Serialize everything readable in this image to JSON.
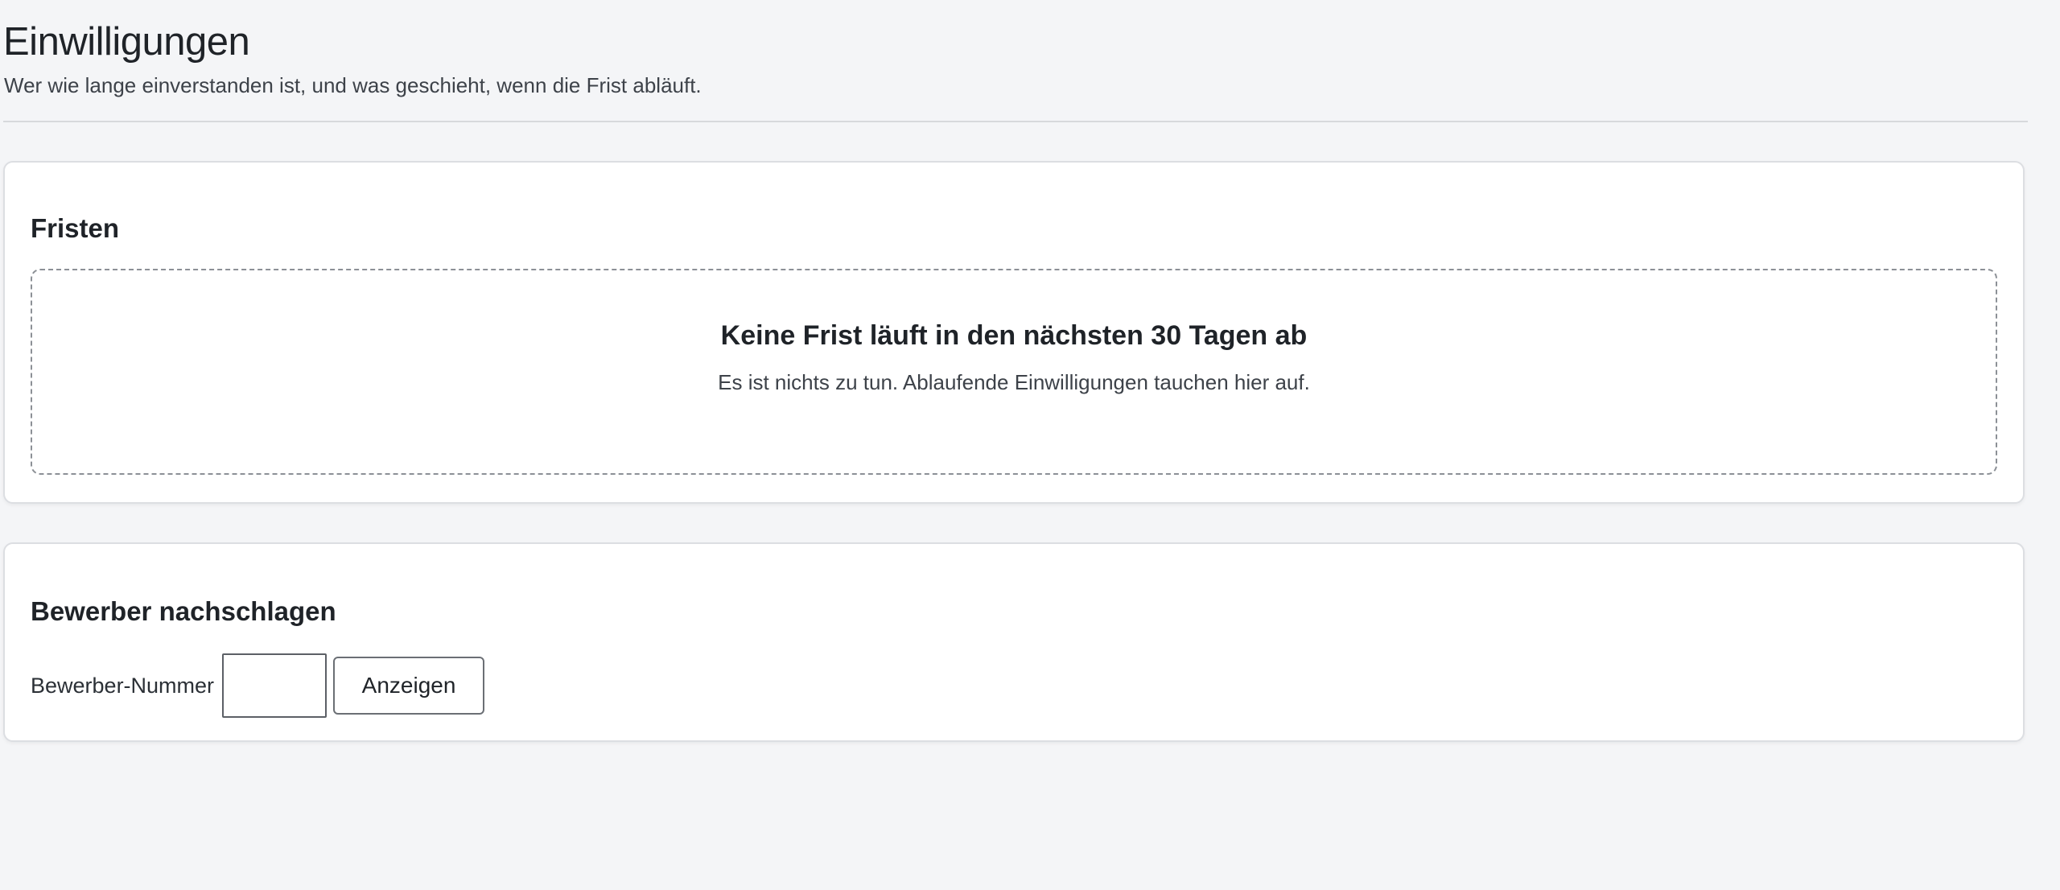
{
  "header": {
    "title": "Einwilligungen",
    "subtitle": "Wer wie lange einverstanden ist, und was geschieht, wenn die Frist abläuft."
  },
  "deadlines": {
    "title": "Fristen",
    "empty_title": "Keine Frist läuft in den nächsten 30 Tagen ab",
    "empty_text": "Es ist nichts zu tun. Ablaufende Einwilligungen tauchen hier auf."
  },
  "lookup": {
    "title": "Bewerber nachschlagen",
    "field_label": "Bewerber-Nummer",
    "field_value": "",
    "button_label": "Anzeigen"
  }
}
